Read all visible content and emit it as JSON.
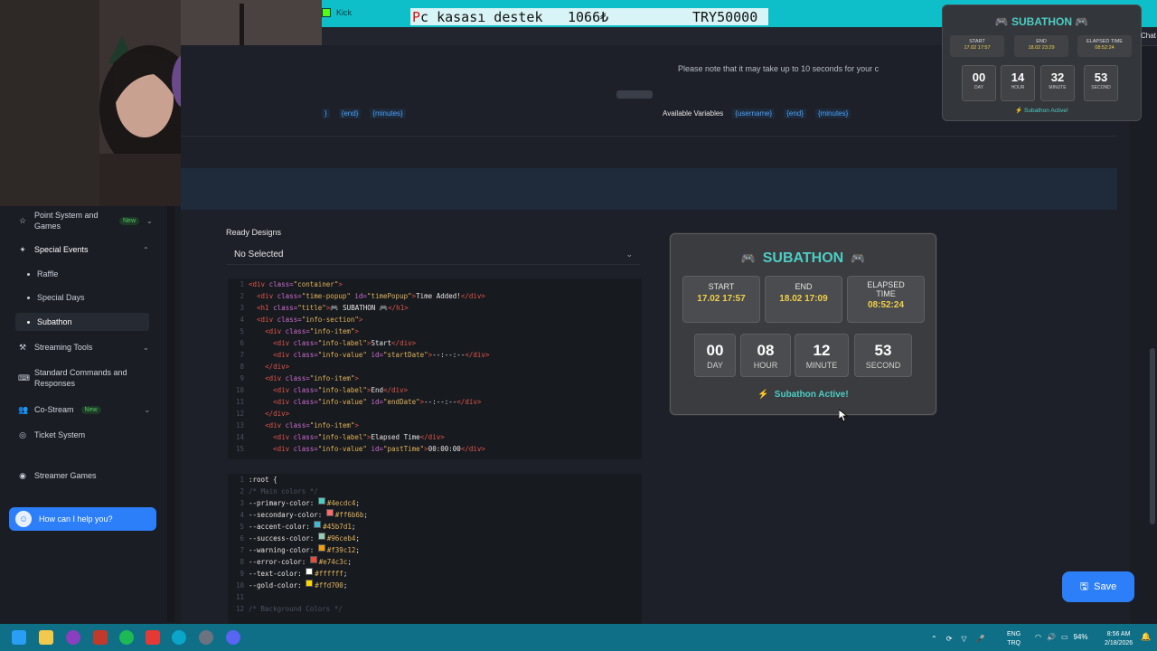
{
  "browser": {
    "tab_title": "Kick",
    "marquee": [
      "Pc kasası destek",
      "1066₺",
      "TRY50000"
    ]
  },
  "top": {
    "note": "Please note that it may take up to 10 seconds for your c",
    "left_vars": [
      "}",
      "{end}",
      "{minutes}"
    ],
    "available_variables_label": "Available Variables",
    "right_vars": [
      "{username}",
      "{end}",
      "{minutes}"
    ],
    "chat_label": "Chat"
  },
  "sidebar": {
    "items": [
      {
        "label": "Point System and Games",
        "badge": "New",
        "icon": "star-icon"
      },
      {
        "label": "Special Events",
        "icon": "sparkle-icon",
        "expanded": true
      },
      {
        "label": "Raffle",
        "sub": true
      },
      {
        "label": "Special Days",
        "sub": true
      },
      {
        "label": "Subathon",
        "sub": true,
        "active": true
      },
      {
        "label": "Streaming Tools",
        "icon": "tools-icon"
      },
      {
        "label": "Standard Commands and Responses",
        "icon": "keyboard-icon"
      },
      {
        "label": "Co-Stream",
        "badge": "New",
        "icon": "users-icon"
      },
      {
        "label": "Ticket System",
        "icon": "ticket-icon"
      },
      {
        "label": "Streamer Games",
        "icon": "gamepad-icon"
      }
    ],
    "help_button": "How can I help you?"
  },
  "designs": {
    "label": "Ready Designs",
    "selected": "No Selected"
  },
  "html_code": [
    {
      "n": "1",
      "parts": [
        [
          "tag",
          "<div "
        ],
        [
          "att",
          "class="
        ],
        [
          "str",
          "\"container\""
        ],
        [
          "tag",
          ">"
        ]
      ]
    },
    {
      "n": "2",
      "parts": [
        [
          "txt",
          "  "
        ],
        [
          "tag",
          "<div "
        ],
        [
          "att",
          "class="
        ],
        [
          "str",
          "\"time-popup\" "
        ],
        [
          "att",
          "id="
        ],
        [
          "str",
          "\"timePopup\""
        ],
        [
          "tag",
          ">"
        ],
        [
          "txt",
          "Time Added!"
        ],
        [
          "tag",
          "</div>"
        ]
      ]
    },
    {
      "n": "3",
      "parts": [
        [
          "txt",
          "  "
        ],
        [
          "tag",
          "<h1 "
        ],
        [
          "att",
          "class="
        ],
        [
          "str",
          "\"title\""
        ],
        [
          "tag",
          ">"
        ],
        [
          "txt",
          "🎮 SUBATHON 🎮"
        ],
        [
          "tag",
          "</h1>"
        ]
      ]
    },
    {
      "n": "4",
      "parts": [
        [
          "txt",
          "  "
        ],
        [
          "tag",
          "<div "
        ],
        [
          "att",
          "class="
        ],
        [
          "str",
          "\"info-section\""
        ],
        [
          "tag",
          ">"
        ]
      ]
    },
    {
      "n": "5",
      "parts": [
        [
          "txt",
          "    "
        ],
        [
          "tag",
          "<div "
        ],
        [
          "att",
          "class="
        ],
        [
          "str",
          "\"info-item\""
        ],
        [
          "tag",
          ">"
        ]
      ]
    },
    {
      "n": "6",
      "parts": [
        [
          "txt",
          "      "
        ],
        [
          "tag",
          "<div "
        ],
        [
          "att",
          "class="
        ],
        [
          "str",
          "\"info-label\""
        ],
        [
          "tag",
          ">"
        ],
        [
          "txt",
          "Start"
        ],
        [
          "tag",
          "</div>"
        ]
      ]
    },
    {
      "n": "7",
      "parts": [
        [
          "txt",
          "      "
        ],
        [
          "tag",
          "<div "
        ],
        [
          "att",
          "class="
        ],
        [
          "str",
          "\"info-value\" "
        ],
        [
          "att",
          "id="
        ],
        [
          "str",
          "\"startDate\""
        ],
        [
          "tag",
          ">"
        ],
        [
          "txt",
          "--:--:--"
        ],
        [
          "tag",
          "</div>"
        ]
      ]
    },
    {
      "n": "8",
      "parts": [
        [
          "txt",
          "    "
        ],
        [
          "tag",
          "</div>"
        ]
      ]
    },
    {
      "n": "9",
      "parts": [
        [
          "txt",
          "    "
        ],
        [
          "tag",
          "<div "
        ],
        [
          "att",
          "class="
        ],
        [
          "str",
          "\"info-item\""
        ],
        [
          "tag",
          ">"
        ]
      ]
    },
    {
      "n": "10",
      "parts": [
        [
          "txt",
          "      "
        ],
        [
          "tag",
          "<div "
        ],
        [
          "att",
          "class="
        ],
        [
          "str",
          "\"info-label\""
        ],
        [
          "tag",
          ">"
        ],
        [
          "txt",
          "End"
        ],
        [
          "tag",
          "</div>"
        ]
      ]
    },
    {
      "n": "11",
      "parts": [
        [
          "txt",
          "      "
        ],
        [
          "tag",
          "<div "
        ],
        [
          "att",
          "class="
        ],
        [
          "str",
          "\"info-value\" "
        ],
        [
          "att",
          "id="
        ],
        [
          "str",
          "\"endDate\""
        ],
        [
          "tag",
          ">"
        ],
        [
          "txt",
          "--:--:--"
        ],
        [
          "tag",
          "</div>"
        ]
      ]
    },
    {
      "n": "12",
      "parts": [
        [
          "txt",
          "    "
        ],
        [
          "tag",
          "</div>"
        ]
      ]
    },
    {
      "n": "13",
      "parts": [
        [
          "txt",
          "    "
        ],
        [
          "tag",
          "<div "
        ],
        [
          "att",
          "class="
        ],
        [
          "str",
          "\"info-item\""
        ],
        [
          "tag",
          ">"
        ]
      ]
    },
    {
      "n": "14",
      "parts": [
        [
          "txt",
          "      "
        ],
        [
          "tag",
          "<div "
        ],
        [
          "att",
          "class="
        ],
        [
          "str",
          "\"info-label\""
        ],
        [
          "tag",
          ">"
        ],
        [
          "txt",
          "Elapsed Time"
        ],
        [
          "tag",
          "</div>"
        ]
      ]
    },
    {
      "n": "15",
      "parts": [
        [
          "txt",
          "      "
        ],
        [
          "tag",
          "<div "
        ],
        [
          "att",
          "class="
        ],
        [
          "str",
          "\"info-value\" "
        ],
        [
          "att",
          "id="
        ],
        [
          "str",
          "\"pastTime\""
        ],
        [
          "tag",
          ">"
        ],
        [
          "txt",
          "00:00:00"
        ],
        [
          "tag",
          "</div>"
        ]
      ]
    }
  ],
  "css_code": [
    {
      "n": "1",
      "parts": [
        [
          "txt",
          ":root {"
        ]
      ]
    },
    {
      "n": "2",
      "parts": [
        [
          "cmt",
          "/* Main colors */"
        ]
      ]
    },
    {
      "n": "3",
      "parts": [
        [
          "prop",
          "--primary-color: "
        ],
        [
          "sw",
          "#4ecdc4"
        ],
        [
          "hex",
          "#4ecdc4"
        ],
        [
          "txt",
          ";"
        ]
      ]
    },
    {
      "n": "4",
      "parts": [
        [
          "prop",
          "--secondary-color: "
        ],
        [
          "sw",
          "#ff6b6b"
        ],
        [
          "hex",
          "#ff6b6b"
        ],
        [
          "txt",
          ";"
        ]
      ]
    },
    {
      "n": "5",
      "parts": [
        [
          "prop",
          "--accent-color: "
        ],
        [
          "sw",
          "#45b7d1"
        ],
        [
          "hex",
          "#45b7d1"
        ],
        [
          "txt",
          ";"
        ]
      ]
    },
    {
      "n": "6",
      "parts": [
        [
          "prop",
          "--success-color: "
        ],
        [
          "sw",
          "#96ceb4"
        ],
        [
          "hex",
          "#96ceb4"
        ],
        [
          "txt",
          ";"
        ]
      ]
    },
    {
      "n": "7",
      "parts": [
        [
          "prop",
          "--warning-color: "
        ],
        [
          "sw",
          "#f39c12"
        ],
        [
          "hex",
          "#f39c12"
        ],
        [
          "txt",
          ";"
        ]
      ]
    },
    {
      "n": "8",
      "parts": [
        [
          "prop",
          "--error-color: "
        ],
        [
          "sw",
          "#e74c3c"
        ],
        [
          "hex",
          "#e74c3c"
        ],
        [
          "txt",
          ";"
        ]
      ]
    },
    {
      "n": "9",
      "parts": [
        [
          "prop",
          "--text-color: "
        ],
        [
          "sw",
          "#ffffff"
        ],
        [
          "hex",
          "#ffffff"
        ],
        [
          "txt",
          ";"
        ]
      ]
    },
    {
      "n": "10",
      "parts": [
        [
          "prop",
          "--gold-color: "
        ],
        [
          "sw",
          "#ffd700"
        ],
        [
          "hex",
          "#ffd700"
        ],
        [
          "txt",
          ";"
        ]
      ]
    },
    {
      "n": "11",
      "parts": [
        [
          "txt",
          ""
        ]
      ]
    },
    {
      "n": "12",
      "parts": [
        [
          "cmt",
          "/* Background Colors */"
        ]
      ]
    }
  ],
  "preview": {
    "title": "SUBATHON",
    "start_label": "START",
    "start_value": "17.02 17:57",
    "end_label": "END",
    "end_value": "18.02 17:09",
    "elapsed_label": "ELAPSED TIME",
    "elapsed_value": "08:52:24",
    "units": [
      {
        "n": "00",
        "u": "DAY"
      },
      {
        "n": "08",
        "u": "HOUR"
      },
      {
        "n": "12",
        "u": "MINUTE"
      },
      {
        "n": "53",
        "u": "SECOND"
      }
    ],
    "status": "Subathon Active!"
  },
  "mini": {
    "title": "SUBATHON",
    "start_label": "START",
    "start_value": "17.02 17:57",
    "end_label": "END",
    "end_value": "18.02 23:29",
    "elapsed_label": "ELAPSED TIME",
    "elapsed_value": "08:52:24",
    "units": [
      {
        "n": "00",
        "u": "DAY"
      },
      {
        "n": "14",
        "u": "HOUR"
      },
      {
        "n": "32",
        "u": "MINUTE"
      },
      {
        "n": "53",
        "u": "SECOND"
      }
    ],
    "status": "Subathon Active!"
  },
  "save_label": "Save",
  "taskbar": {
    "lang_top": "ENG",
    "lang_bottom": "TRQ",
    "battery": "94%",
    "time": "8:56 AM",
    "date": "2/18/2026"
  },
  "colors": {
    "primary": "#4ecdc4",
    "accent_blue": "#2d7ff9",
    "gold": "#f1d04a",
    "taskbar": "#0f6f86"
  }
}
